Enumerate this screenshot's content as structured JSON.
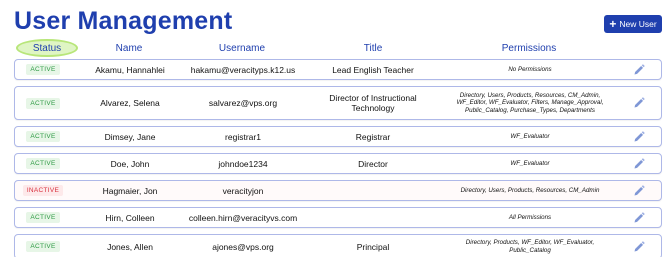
{
  "header": {
    "title": "User Management",
    "new_user_label": "New User",
    "new_user_icon": "plus-icon"
  },
  "columns": {
    "status": "Status",
    "name": "Name",
    "username": "Username",
    "title": "Title",
    "permissions": "Permissions"
  },
  "colors": {
    "brand_blue": "#1f3fae",
    "active_text": "#2e9a44",
    "inactive_text": "#d9303d",
    "row_border": "#aeb8e8",
    "status_header_highlight": "#dff5c4"
  },
  "users": [
    {
      "status": "ACTIVE",
      "name": "Akamu, Hannahlei",
      "username": "hakamu@veracityps.k12.us",
      "title": "Lead English Teacher",
      "permissions": "No Permissions",
      "edit_icon": "pencil-icon"
    },
    {
      "status": "ACTIVE",
      "name": "Alvarez, Selena",
      "username": "salvarez@vps.org",
      "title": "Director of Instructional Technology",
      "permissions": "Directory, Users, Products, Resources, CM_Admin, WF_Editor, WF_Evaluator, Filters, Manage_Approval, Public_Catalog, Purchase_Types, Departments",
      "edit_icon": "pencil-icon"
    },
    {
      "status": "ACTIVE",
      "name": "Dimsey, Jane",
      "username": "registrar1",
      "title": "Registrar",
      "permissions": "WF_Evaluator",
      "edit_icon": "pencil-icon"
    },
    {
      "status": "ACTIVE",
      "name": "Doe, John",
      "username": "johndoe1234",
      "title": "Director",
      "permissions": "WF_Evaluator",
      "edit_icon": "pencil-icon"
    },
    {
      "status": "INACTIVE",
      "name": "Hagmaier, Jon",
      "username": "veracityjon",
      "title": "",
      "permissions": "Directory, Users, Products, Resources, CM_Admin",
      "edit_icon": "pencil-icon"
    },
    {
      "status": "ACTIVE",
      "name": "Hirn, Colleen",
      "username": "colleen.hirn@veracityvs.com",
      "title": "",
      "permissions": "All Permissions",
      "edit_icon": "pencil-icon"
    },
    {
      "status": "ACTIVE",
      "name": "Jones, Allen",
      "username": "ajones@vps.org",
      "title": "Principal",
      "permissions": "Directory, Products, WF_Editor, WF_Evaluator, Public_Catalog",
      "edit_icon": "pencil-icon"
    }
  ]
}
